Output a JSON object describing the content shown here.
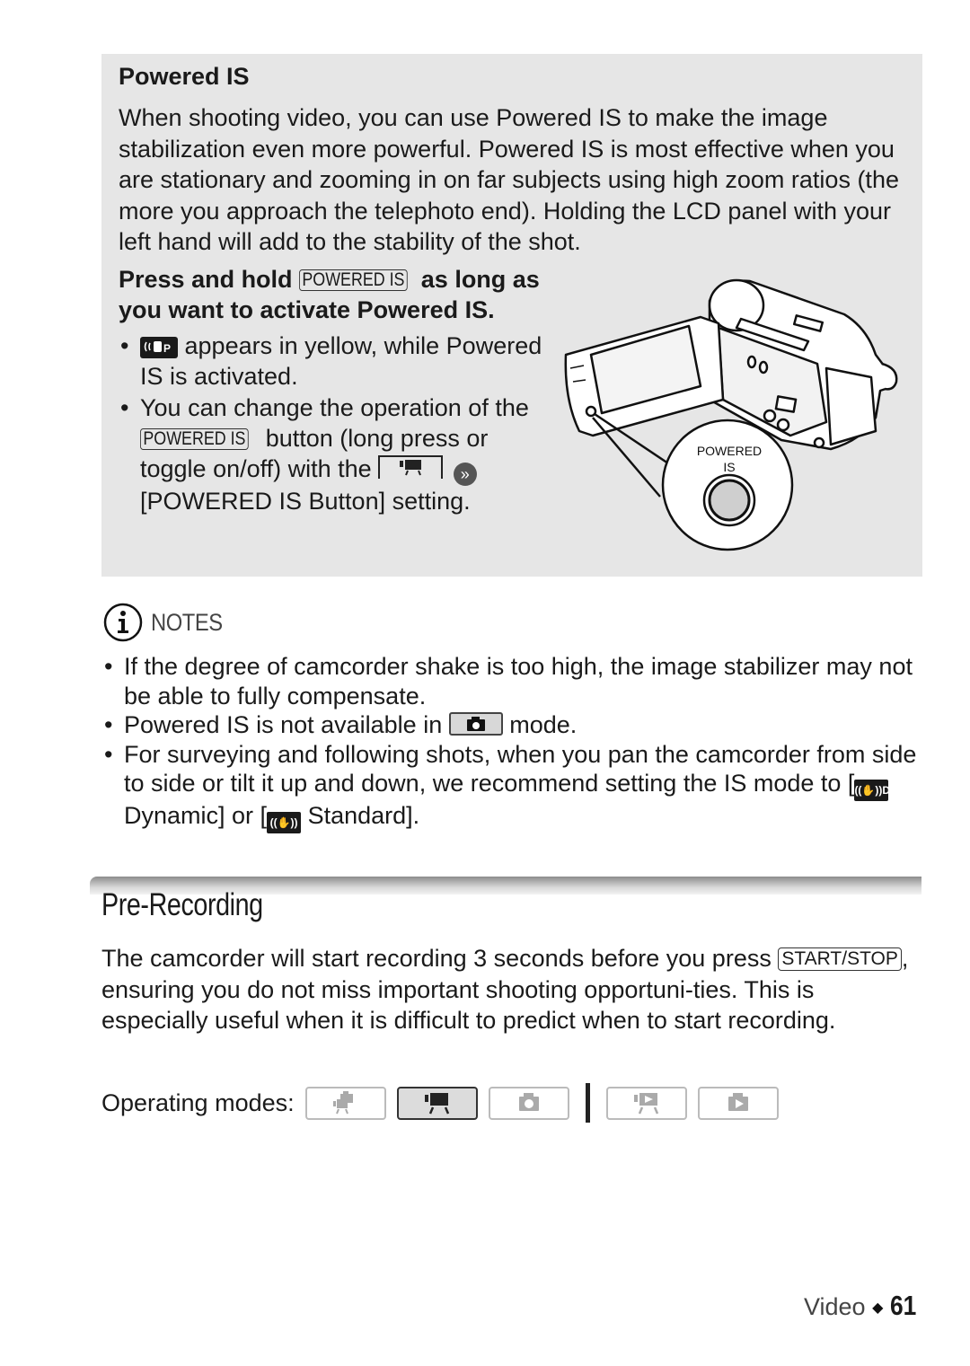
{
  "powered_is_box": {
    "title": "Powered IS",
    "intro": "When shooting video, you can use Powered IS to make the image stabilization even more powerful. Powered IS is most effective when you are stationary and zooming in on far subjects using high zoom ratios (the more you approach the telephoto end). Holding the LCD panel with your left hand will add to the stability of the shot.",
    "press_prefix": "Press and hold",
    "press_key": "POWERED IS",
    "press_suffix": "as long as you want to activate Powered IS.",
    "bullets": [
      {
        "icon": "powered-is-icon",
        "icon_text": "((✋))P",
        "text": "appears in yellow, while Powered  IS is activated."
      },
      {
        "part1": "You can change the operation of the",
        "key": "POWERED IS",
        "part2": "button (long press or toggle on/off) with the",
        "part3": "[POWERED IS Button] setting."
      }
    ],
    "illustration": {
      "label_line1": "POWERED",
      "label_line2": "IS"
    }
  },
  "notes": {
    "heading": "NOTES",
    "items": [
      {
        "text": "If the degree of camcorder shake is too high, the image stabilizer may not be able to fully compensate."
      },
      {
        "prefix": "Powered IS is not available in",
        "suffix": "mode."
      },
      {
        "prefix": "For surveying and following shots, when you pan the camcorder from side to side or tilt it up and down, we recommend setting the IS mode to [",
        "dynamic": "Dynamic] or [",
        "standard": "Standard]."
      }
    ]
  },
  "pre_recording": {
    "title": "Pre-Recording",
    "body_part1": "The camcorder will start recording 3 seconds before you press",
    "key": "START/STOP",
    "body_part2": ", ensuring you do not miss important shooting opportuni-ties. This is especially useful when it is difficult to predict when to start recording.",
    "modes_label": "Operating modes:",
    "modes": [
      {
        "name": "dual-shot",
        "active": false
      },
      {
        "name": "movie-recording",
        "active": true
      },
      {
        "name": "photo-recording",
        "active": false
      },
      {
        "name": "movie-playback",
        "active": false
      },
      {
        "name": "photo-playback",
        "active": false
      }
    ]
  },
  "footer": {
    "section": "Video",
    "separator": "◆",
    "page": "61"
  }
}
